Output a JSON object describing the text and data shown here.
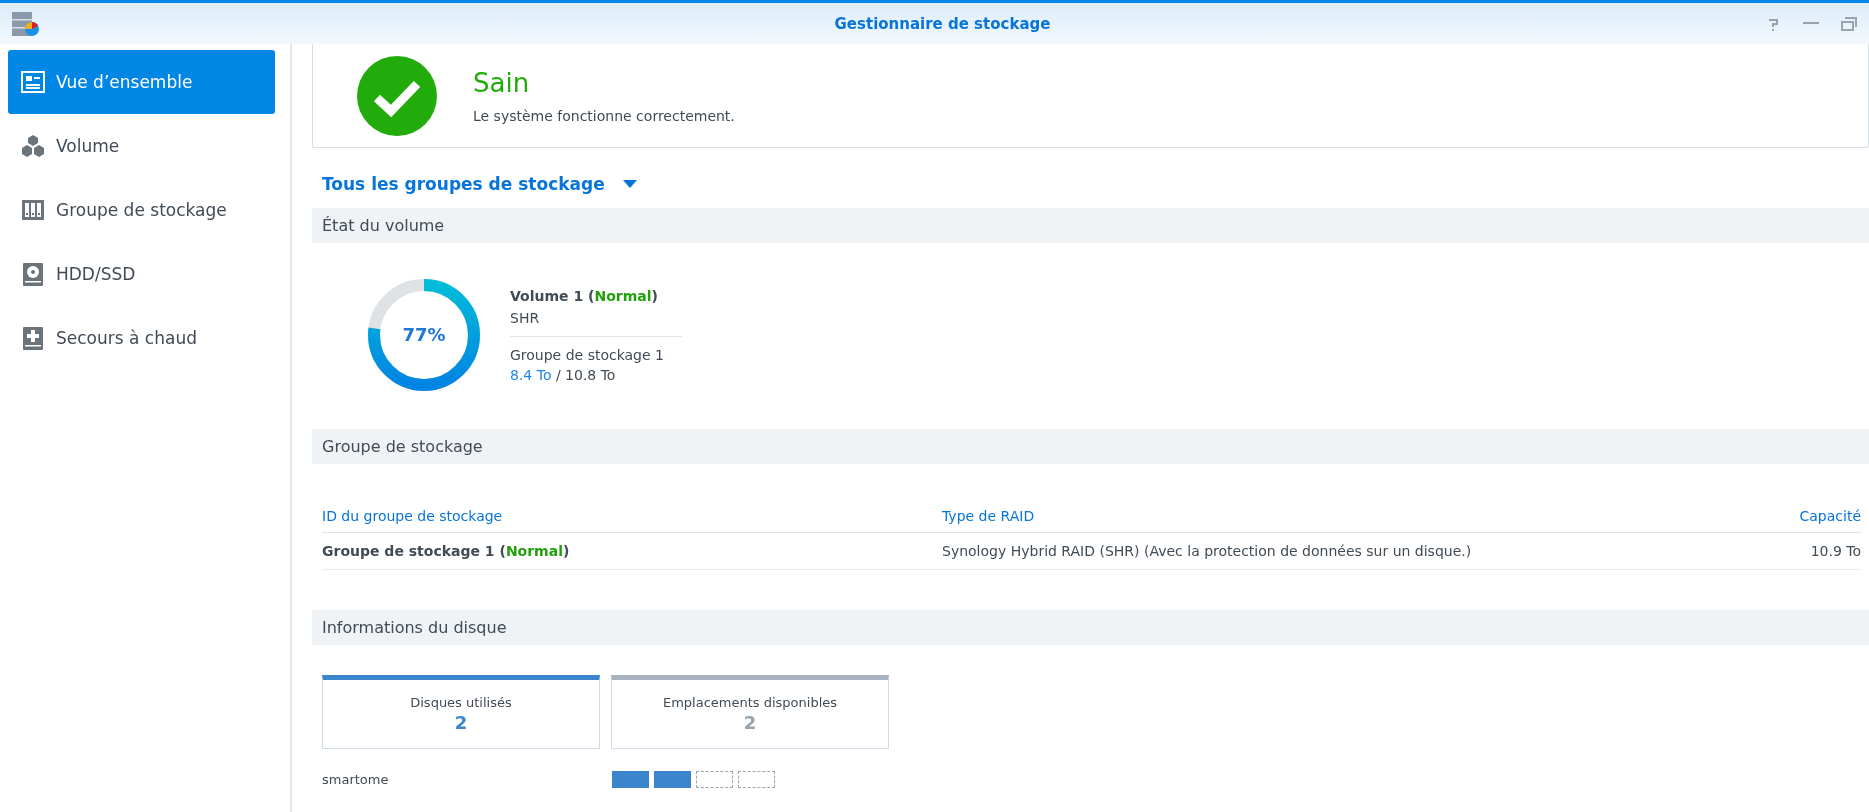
{
  "window": {
    "title": "Gestionnaire de stockage"
  },
  "sidebar": {
    "items": [
      {
        "label": "Vue d’ensemble",
        "kind": "overview",
        "selected": true
      },
      {
        "label": "Volume",
        "kind": "volume",
        "selected": false
      },
      {
        "label": "Groupe de stockage",
        "kind": "pool",
        "selected": false
      },
      {
        "label": "HDD/SSD",
        "kind": "disk",
        "selected": false
      },
      {
        "label": "Secours à chaud",
        "kind": "hotspare",
        "selected": false
      }
    ]
  },
  "health": {
    "status": "Sain",
    "message": "Le système fonctionne correctement."
  },
  "filter": {
    "label": "Tous les groupes de stockage"
  },
  "volume_section": {
    "title": "État du volume",
    "volumes": [
      {
        "usage": "77%",
        "level": 0.77,
        "title": [
          {
            "text": "Volume 1 ("
          },
          {
            "text": "Normal",
            "kind": "status"
          },
          {
            "text": ")"
          }
        ],
        "raid": "SHR",
        "pool": "Groupe de stockage 1",
        "capacity": [
          {
            "text": "8.4 To",
            "kind": "used"
          },
          {
            "text": " / 10.8 To",
            "kind": "total"
          }
        ]
      }
    ]
  },
  "pool_section": {
    "title": "Groupe de stockage",
    "columns": [
      "ID du groupe de stockage",
      "Type de RAID",
      "Capacité"
    ],
    "rows": [
      {
        "id": [
          {
            "text": "Groupe de stockage 1 ("
          },
          {
            "text": "Normal",
            "kind": "status"
          },
          {
            "text": ")"
          }
        ],
        "raid": "Synology Hybrid RAID (SHR) (Avec la protection de données sur un disque.)",
        "capacity": "10.9 To"
      }
    ]
  },
  "disk_section": {
    "title": "Informations du disque",
    "cards": [
      {
        "label": "Disques utilisés",
        "value": "2",
        "kind": "used"
      },
      {
        "label": "Emplacements disponibles",
        "value": "2",
        "kind": "available"
      }
    ],
    "host": "smartome",
    "slots": [
      {
        "occupied": true
      },
      {
        "occupied": true
      },
      {
        "occupied": false
      },
      {
        "occupied": false
      }
    ]
  }
}
